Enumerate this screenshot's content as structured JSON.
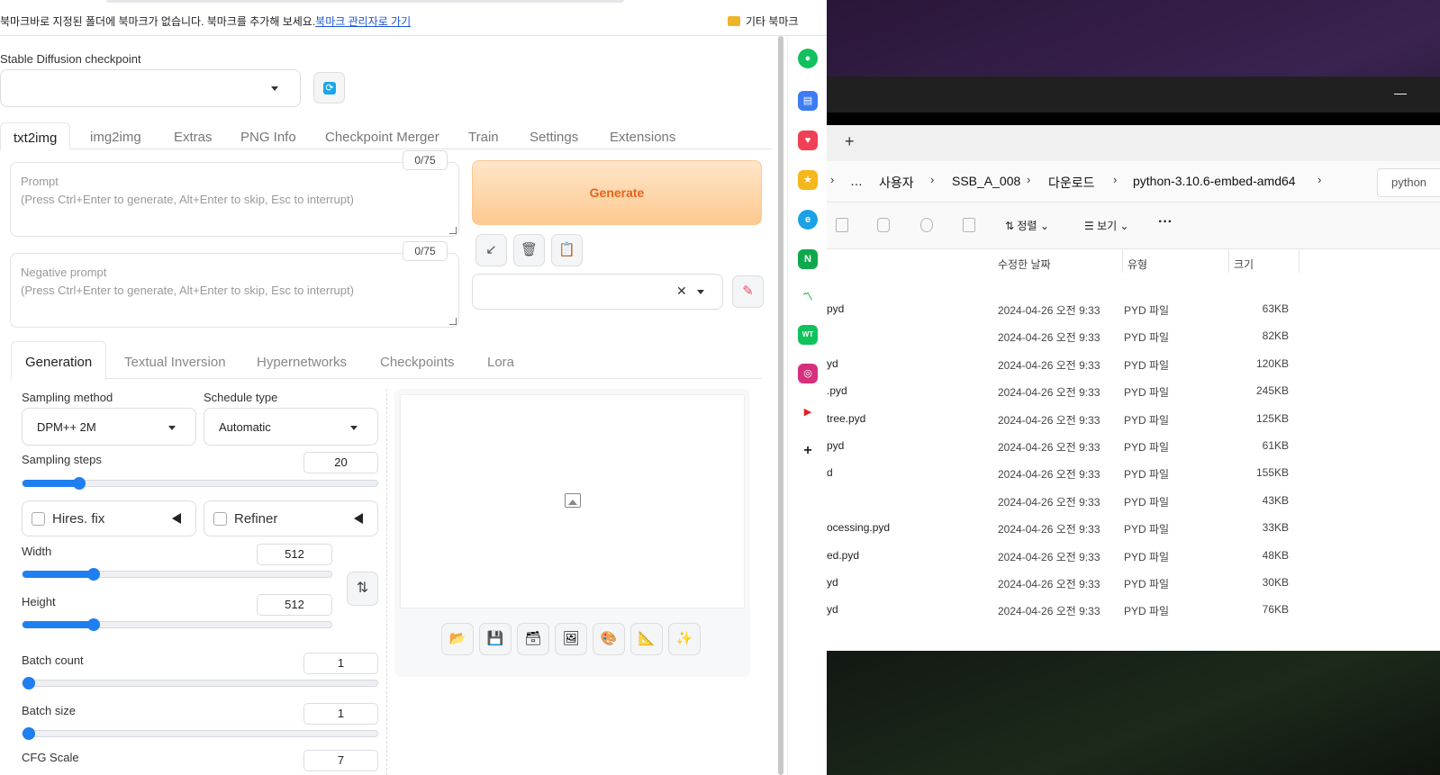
{
  "bookmarks": {
    "message": "북마크바로 지정된 폴더에 북마크가 없습니다. 북마크를 추가해 보세요.",
    "manage_link": "북마크 관리자로 가기",
    "other": "기타 북마크"
  },
  "checkpoint": {
    "label": "Stable Diffusion checkpoint",
    "value": ""
  },
  "main_tabs": [
    "txt2img",
    "img2img",
    "Extras",
    "PNG Info",
    "Checkpoint Merger",
    "Train",
    "Settings",
    "Extensions"
  ],
  "prompt": {
    "label": "Prompt",
    "hint": "(Press Ctrl+Enter to generate, Alt+Enter to skip, Esc to interrupt)",
    "counter": "0/75"
  },
  "negative_prompt": {
    "label": "Negative prompt",
    "hint": "(Press Ctrl+Enter to generate, Alt+Enter to skip, Esc to interrupt)",
    "counter": "0/75"
  },
  "generate_label": "Generate",
  "sub_tabs": [
    "Generation",
    "Textual Inversion",
    "Hypernetworks",
    "Checkpoints",
    "Lora"
  ],
  "generation": {
    "sampling_method_label": "Sampling method",
    "sampling_method": "DPM++ 2M",
    "schedule_type_label": "Schedule type",
    "schedule_type": "Automatic",
    "sampling_steps_label": "Sampling steps",
    "sampling_steps": "20",
    "hires_fix": "Hires. fix",
    "refiner": "Refiner",
    "width_label": "Width",
    "width": "512",
    "height_label": "Height",
    "height": "512",
    "batch_count_label": "Batch count",
    "batch_count": "1",
    "batch_size_label": "Batch size",
    "batch_size": "1",
    "cfg_scale_label": "CFG Scale",
    "cfg_scale": "7"
  },
  "sliders": {
    "sampling_steps": 0.16,
    "width": 0.23,
    "height": 0.23,
    "batch_count": 0.0,
    "batch_size": 0.0
  },
  "explorer": {
    "breadcrumb": [
      "…",
      "사용자",
      "SSB_A_008",
      "다운로드",
      "python-3.10.6-embed-amd64"
    ],
    "search_text": "python",
    "toolbar": {
      "sort": "정렬",
      "view": "보기",
      "more": "···"
    },
    "columns": [
      "수정한 날짜",
      "유형",
      "크기"
    ],
    "rows": [
      {
        "name": "pyd",
        "date": "2024-04-26 오전 9:33",
        "type": "PYD 파일",
        "size": "63KB"
      },
      {
        "name": "",
        "date": "2024-04-26 오전 9:33",
        "type": "PYD 파일",
        "size": "82KB"
      },
      {
        "name": "yd",
        "date": "2024-04-26 오전 9:33",
        "type": "PYD 파일",
        "size": "120KB"
      },
      {
        "name": ".pyd",
        "date": "2024-04-26 오전 9:33",
        "type": "PYD 파일",
        "size": "245KB"
      },
      {
        "name": "tree.pyd",
        "date": "2024-04-26 오전 9:33",
        "type": "PYD 파일",
        "size": "125KB"
      },
      {
        "name": "pyd",
        "date": "2024-04-26 오전 9:33",
        "type": "PYD 파일",
        "size": "61KB"
      },
      {
        "name": "d",
        "date": "2024-04-26 오전 9:33",
        "type": "PYD 파일",
        "size": "155KB"
      },
      {
        "name": "",
        "date": "2024-04-26 오전 9:33",
        "type": "PYD 파일",
        "size": "43KB"
      },
      {
        "name": "ocessing.pyd",
        "date": "2024-04-26 오전 9:33",
        "type": "PYD 파일",
        "size": "33KB"
      },
      {
        "name": "ed.pyd",
        "date": "2024-04-26 오전 9:33",
        "type": "PYD 파일",
        "size": "48KB"
      },
      {
        "name": "yd",
        "date": "2024-04-26 오전 9:33",
        "type": "PYD 파일",
        "size": "30KB"
      },
      {
        "name": "yd",
        "date": "2024-04-26 오전 9:33",
        "type": "PYD 파일",
        "size": "76KB"
      }
    ]
  },
  "colors": {
    "accent": "#1e7ff0",
    "generate_text": "#e8641a",
    "link": "#1a55d4"
  }
}
